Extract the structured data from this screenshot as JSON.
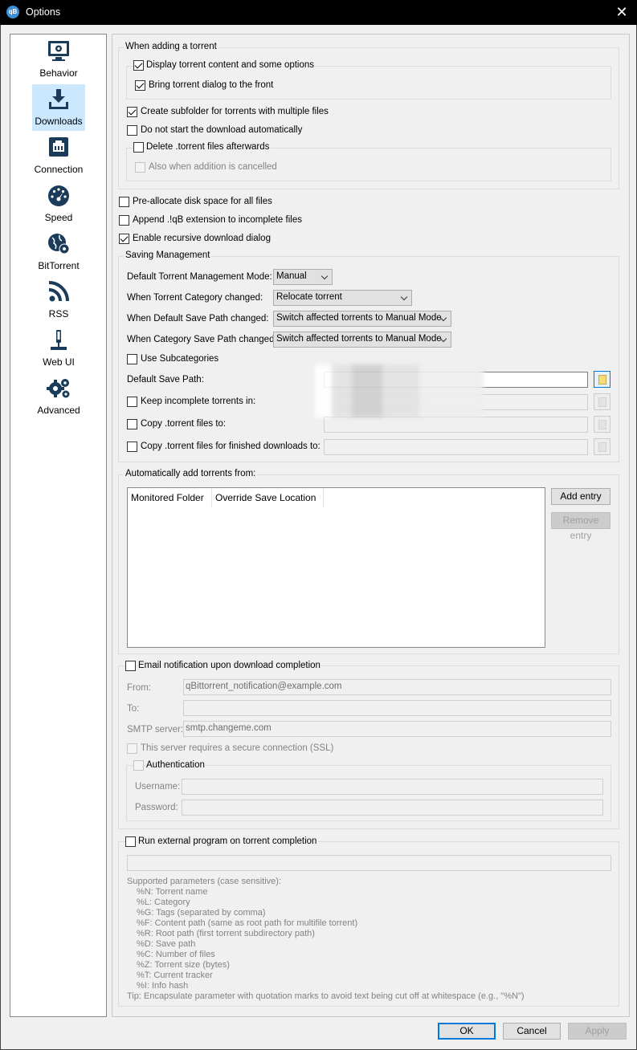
{
  "window": {
    "title": "Options",
    "close_glyph": "✕",
    "app_icon": "qB"
  },
  "sidebar": {
    "items": [
      {
        "label": "Behavior",
        "icon": "monitor-gear-icon"
      },
      {
        "label": "Downloads",
        "icon": "download-tray-icon",
        "active": true
      },
      {
        "label": "Connection",
        "icon": "network-port-icon"
      },
      {
        "label": "Speed",
        "icon": "speedometer-icon"
      },
      {
        "label": "BitTorrent",
        "icon": "globe-gear-icon"
      },
      {
        "label": "RSS",
        "icon": "rss-feed-icon"
      },
      {
        "label": "Web UI",
        "icon": "network-plug-icon"
      },
      {
        "label": "Advanced",
        "icon": "gears-icon"
      }
    ]
  },
  "adding": {
    "title": "When adding a torrent",
    "display_content": "Display torrent content and some options",
    "bring_front": "Bring torrent dialog to the front",
    "create_subfolder": "Create subfolder for torrents with multiple files",
    "do_not_start": "Do not start the download automatically",
    "delete_torrent": "Delete .torrent files afterwards",
    "also_cancelled": "Also when addition is cancelled"
  },
  "general": {
    "preallocate": "Pre-allocate disk space for all files",
    "append_ext": "Append .!qB extension to incomplete files",
    "recursive": "Enable recursive download dialog"
  },
  "saving": {
    "title": "Saving Management",
    "mode_label": "Default Torrent Management Mode:",
    "mode_value": "Manual",
    "category_changed_label": "When Torrent Category changed:",
    "category_changed_value": "Relocate torrent",
    "default_path_changed_label": "When Default Save Path changed:",
    "default_path_changed_value": "Switch affected torrents to Manual Mode",
    "category_path_changed_label": "When Category Save Path changed:",
    "category_path_changed_value": "Switch affected torrents to Manual Mode",
    "use_subcategories": "Use Subcategories",
    "default_save_path": "Default Save Path:",
    "keep_incomplete": "Keep incomplete torrents in:",
    "copy_torrent": "Copy .torrent files to:",
    "copy_finished": "Copy .torrent files for finished downloads to:"
  },
  "auto_add": {
    "title": "Automatically add torrents from:",
    "col_folder": "Monitored Folder",
    "col_override": "Override Save Location",
    "add_entry": "Add entry",
    "remove_entry": "Remove entry"
  },
  "email": {
    "title": "Email notification upon download completion",
    "from_label": "From:",
    "from_value": "qBittorrent_notification@example.com",
    "to_label": "To:",
    "smtp_label": "SMTP server:",
    "smtp_value": "smtp.changeme.com",
    "ssl": "This server requires a secure connection (SSL)",
    "auth": "Authentication",
    "username_label": "Username:",
    "password_label": "Password:"
  },
  "external": {
    "title": "Run external program on torrent completion",
    "supported": "Supported parameters (case sensitive):",
    "params": [
      "%N: Torrent name",
      "%L: Category",
      "%G: Tags (separated by comma)",
      "%F: Content path (same as root path for multifile torrent)",
      "%R: Root path (first torrent subdirectory path)",
      "%D: Save path",
      "%C: Number of files",
      "%Z: Torrent size (bytes)",
      "%T: Current tracker",
      "%I: Info hash"
    ],
    "tip": "Tip: Encapsulate parameter with quotation marks to avoid text being cut off at whitespace (e.g., \"%N\")"
  },
  "buttons": {
    "ok": "OK",
    "cancel": "Cancel",
    "apply": "Apply"
  }
}
